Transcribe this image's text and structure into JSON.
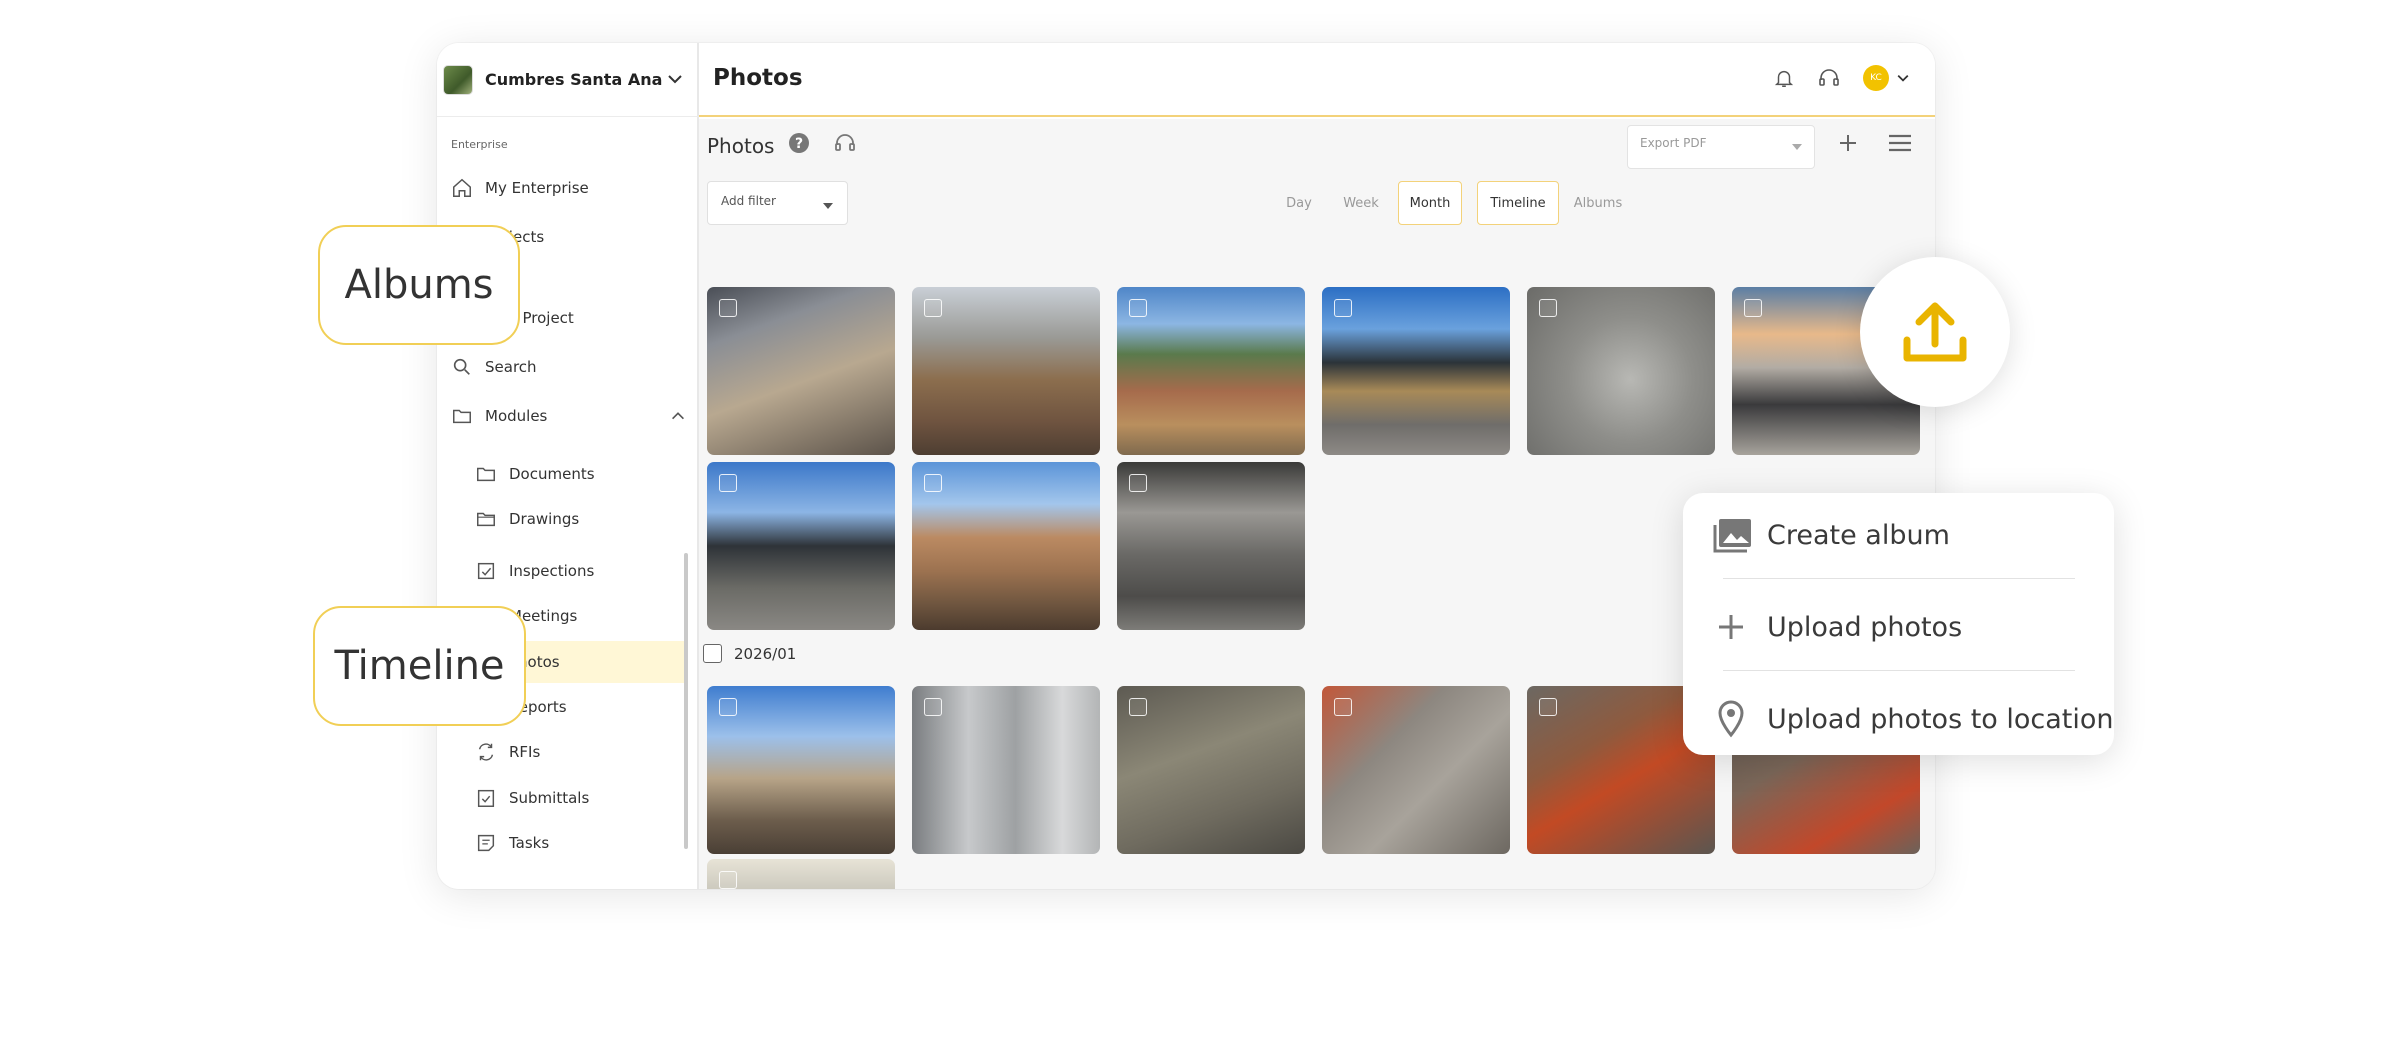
{
  "app": {
    "project_name": "Cumbres Santa Ana",
    "header_title": "Photos",
    "avatar_initials": "KC"
  },
  "sidebar": {
    "section_label": "Enterprise",
    "items": [
      {
        "label": "My Enterprise",
        "icon": "home-icon"
      },
      {
        "label": "Projects",
        "icon": "projects-icon"
      },
      {
        "label": "New Project",
        "icon": "new-project-icon"
      },
      {
        "label": "Search",
        "icon": "search-icon"
      },
      {
        "label": "Modules",
        "icon": "folder-icon"
      }
    ],
    "modules": [
      {
        "label": "Documents",
        "icon": "folder-icon"
      },
      {
        "label": "Drawings",
        "icon": "folder-open-icon"
      },
      {
        "label": "Inspections",
        "icon": "inspections-icon"
      },
      {
        "label": "Meetings",
        "icon": "meetings-icon"
      },
      {
        "label": "Photos",
        "icon": "photos-icon"
      },
      {
        "label": "Reports",
        "icon": "reports-icon"
      },
      {
        "label": "RFIs",
        "icon": "rfi-icon"
      },
      {
        "label": "Submittals",
        "icon": "submittals-icon"
      },
      {
        "label": "Tasks",
        "icon": "tasks-icon"
      }
    ]
  },
  "content": {
    "title": "Photos",
    "export_placeholder": "Export PDF",
    "filter_label": "Add filter",
    "view_tabs": [
      "Day",
      "Week",
      "Month"
    ],
    "active_view": "Month",
    "mode_tabs": [
      "Timeline",
      "Albums"
    ],
    "active_mode": "Timeline",
    "group_date": "2026/01"
  },
  "callouts": {
    "albums": "Albums",
    "timeline": "Timeline"
  },
  "upload_menu": {
    "items": [
      "Create album",
      "Upload photos",
      "Upload photos to location"
    ]
  },
  "colors": {
    "accent": "#f2c200",
    "highlight": "#fff7d6",
    "callout_border": "#f1cf56"
  }
}
